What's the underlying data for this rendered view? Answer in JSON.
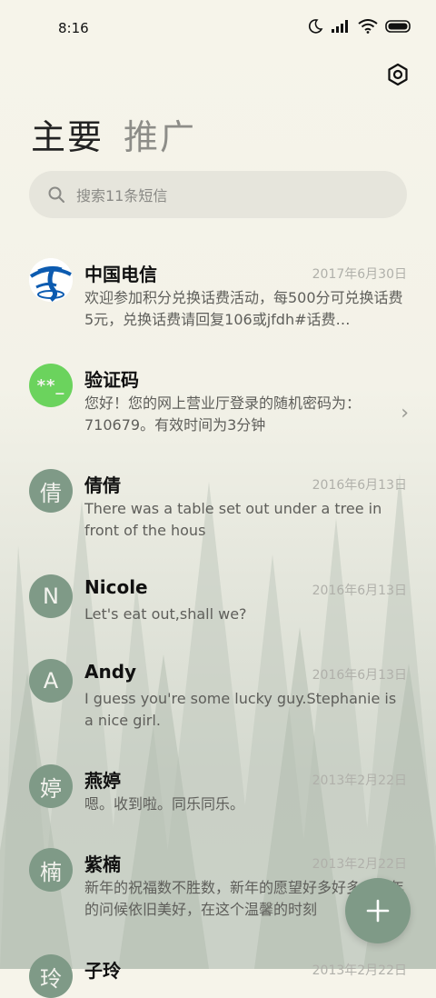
{
  "status": {
    "time": "8:16"
  },
  "tabs": {
    "primary": "主要",
    "promotions": "推广"
  },
  "search": {
    "placeholder": "搜索11条短信"
  },
  "conversations": [
    {
      "name": "中国电信",
      "date": "2017年6月30日",
      "preview": "欢迎参加积分兑换话费活动，每500分可兑换话费5元，兑换话费请回复106或jfdh#话费…",
      "avatar": ""
    },
    {
      "name": "验证码",
      "date": "",
      "preview": "您好！您的网上营业厅登录的随机密码为：710679。有效时间为3分钟",
      "avatar": "**_"
    },
    {
      "name": "倩倩",
      "date": "2016年6月13日",
      "preview": "There was a table set out under a tree in front of the hous",
      "avatar": "倩"
    },
    {
      "name": "Nicole",
      "date": "2016年6月13日",
      "preview": "Let's eat out,shall we?",
      "avatar": "N"
    },
    {
      "name": "Andy",
      "date": "2016年6月13日",
      "preview": "I guess you're some lucky guy.Stephanie is a nice girl.",
      "avatar": "A"
    },
    {
      "name": "燕婷",
      "date": "2013年2月22日",
      "preview": "嗯。收到啦。同乐同乐。",
      "avatar": "婷"
    },
    {
      "name": "紫楠",
      "date": "2013年2月22日",
      "preview": "新年的祝福数不胜数，新年的愿望好多好多，新年的问候依旧美好，在这个温馨的时刻",
      "avatar": "楠"
    },
    {
      "name": "子玲",
      "date": "2013年2月22日",
      "preview": "",
      "avatar": "玲"
    }
  ],
  "colors": {
    "accent": "#7f9a87",
    "code_avatar": "#6bd35d",
    "telecom_blue": "#0c5bb0"
  }
}
